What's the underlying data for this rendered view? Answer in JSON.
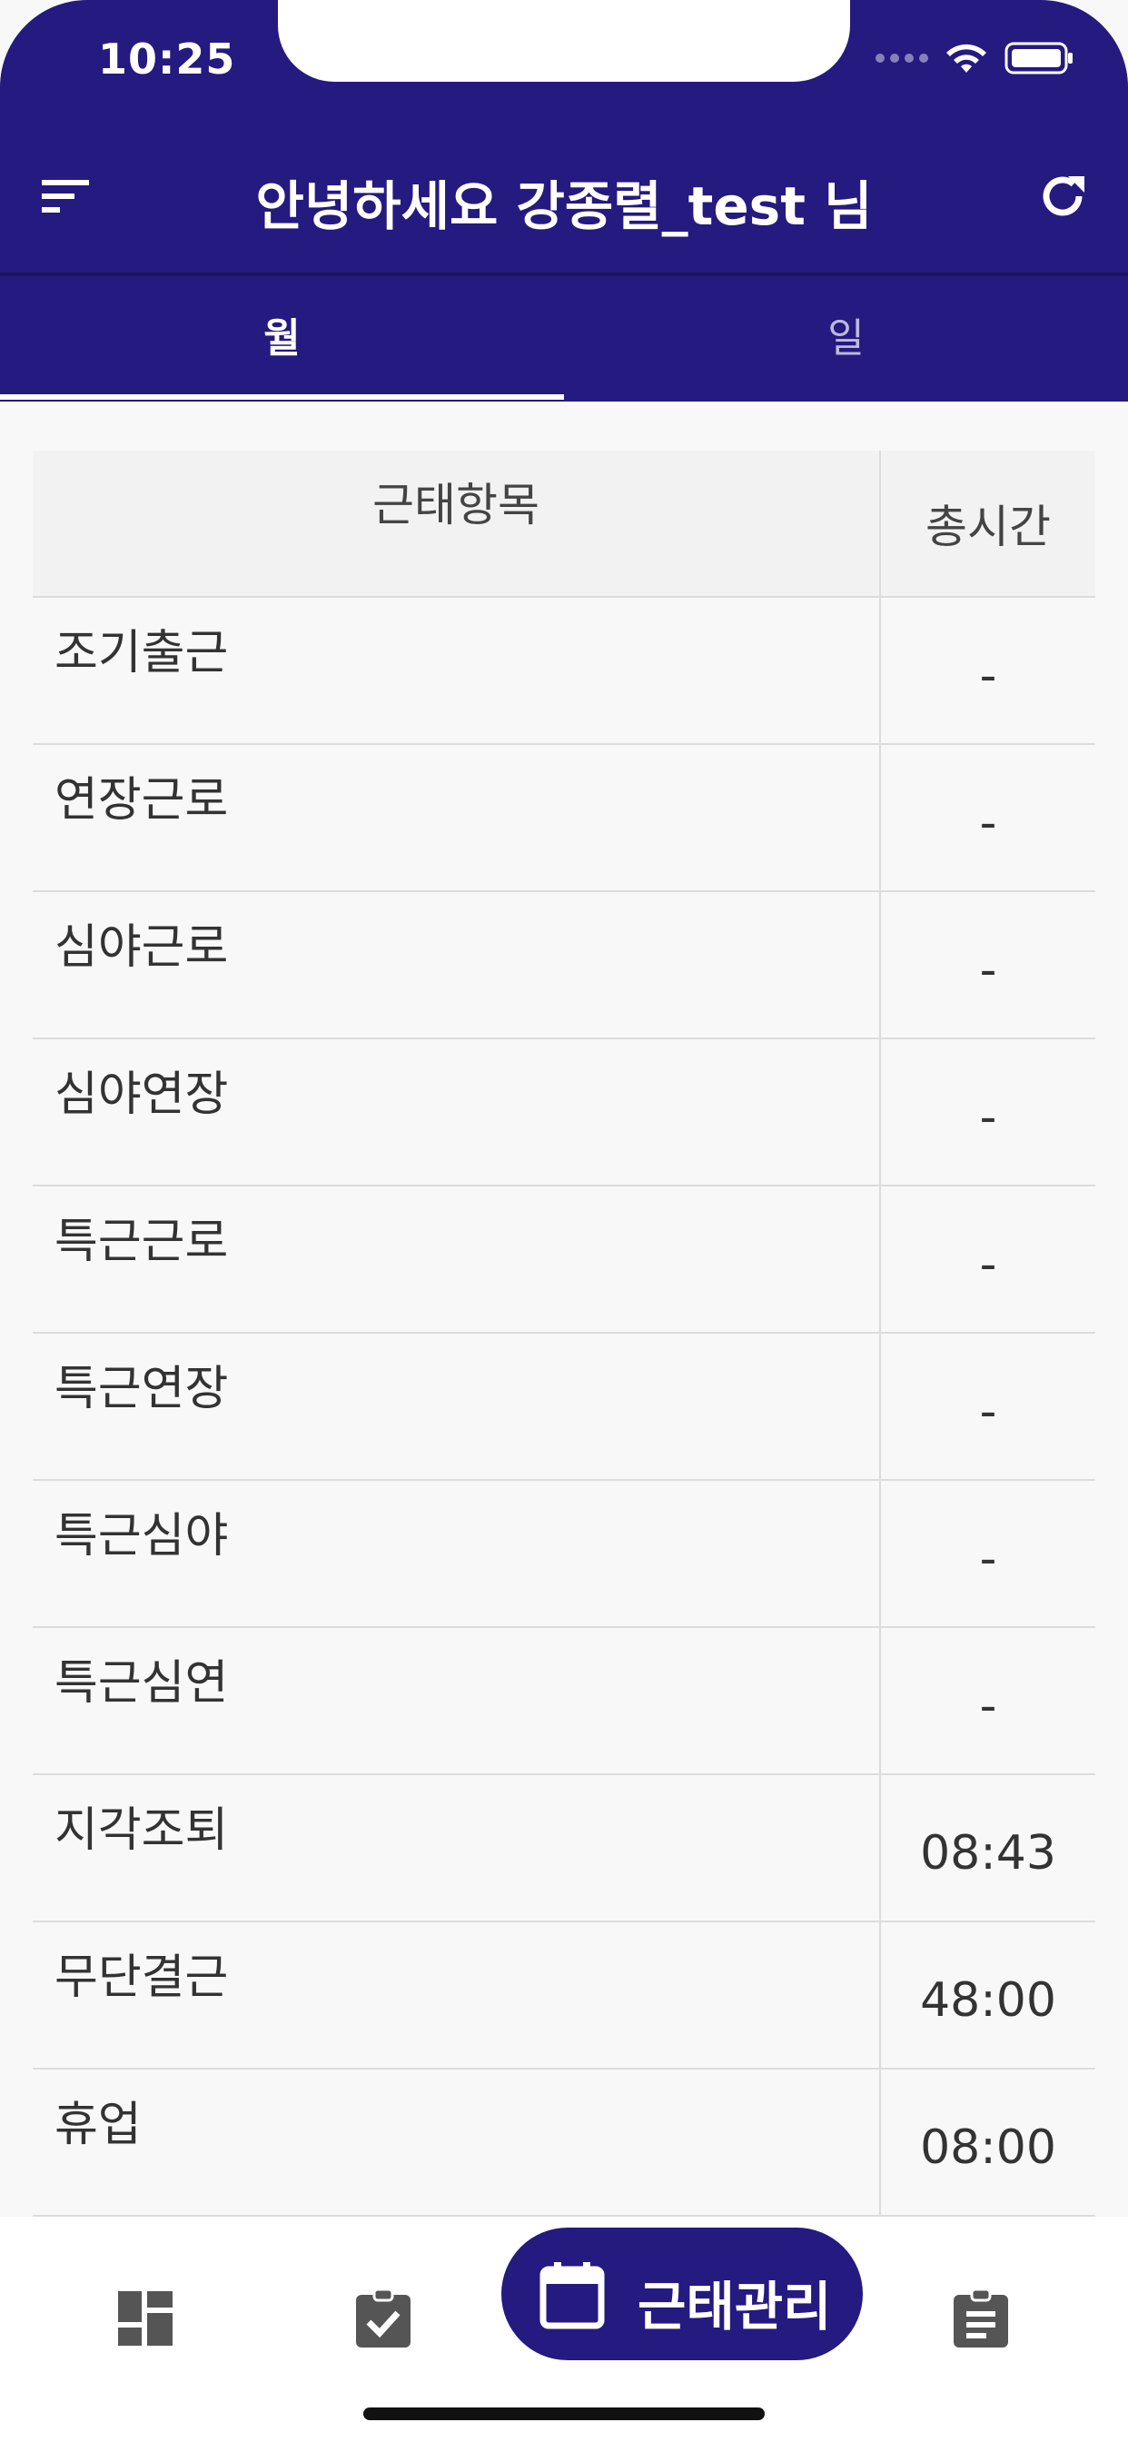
{
  "status_bar": {
    "time": "10:25"
  },
  "header": {
    "title": "안녕하세요 강종렬_test 님"
  },
  "tabs": [
    {
      "label": "월",
      "selected": true
    },
    {
      "label": "일",
      "selected": false
    }
  ],
  "table": {
    "columns": [
      "근태항목",
      "총시간"
    ],
    "rows": [
      {
        "item": "조기출근",
        "total": "-"
      },
      {
        "item": "연장근로",
        "total": "-"
      },
      {
        "item": "심야근로",
        "total": "-"
      },
      {
        "item": "심야연장",
        "total": "-"
      },
      {
        "item": "특근근로",
        "total": "-"
      },
      {
        "item": "특근연장",
        "total": "-"
      },
      {
        "item": "특근심야",
        "total": "-"
      },
      {
        "item": "특근심연",
        "total": "-"
      },
      {
        "item": "지각조퇴",
        "total": "08:43"
      },
      {
        "item": "무단결근",
        "total": "48:00"
      },
      {
        "item": "휴업",
        "total": "08:00"
      }
    ]
  },
  "bottom_nav": {
    "items": [
      {
        "icon": "dashboard-icon"
      },
      {
        "icon": "clipboard-check-icon"
      },
      {
        "icon": "calendar-icon",
        "label": "근태관리",
        "active": true
      },
      {
        "icon": "clipboard-list-icon"
      }
    ]
  },
  "colors": {
    "primary": "#241a80",
    "background": "#f8f8f8"
  }
}
